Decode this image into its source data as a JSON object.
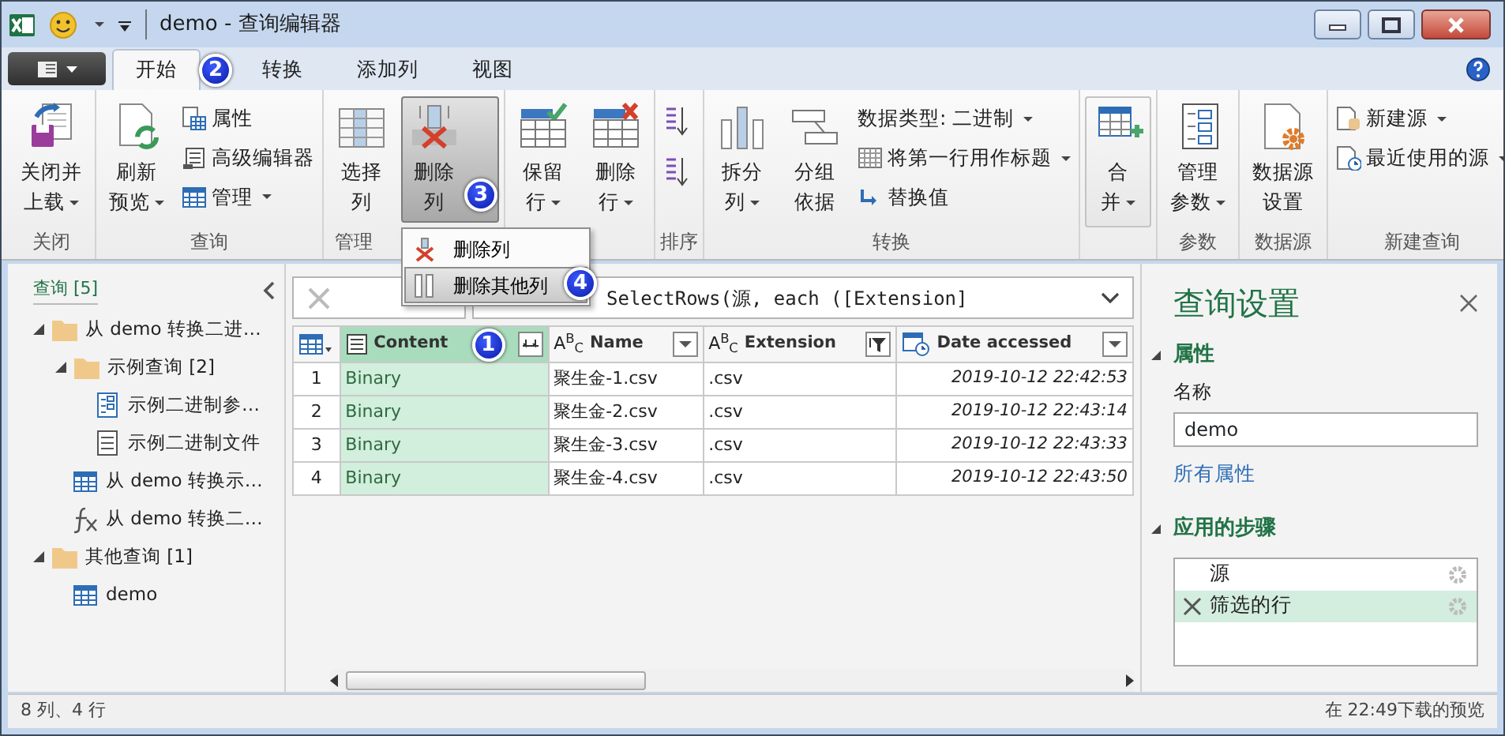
{
  "window": {
    "title": "demo - 查询编辑器"
  },
  "tabs": [
    {
      "label": "开始",
      "selected": true,
      "callout": "2"
    },
    {
      "label": "转换",
      "selected": false
    },
    {
      "label": "添加列",
      "selected": false
    },
    {
      "label": "视图",
      "selected": false
    }
  ],
  "ribbon": [
    {
      "label": "关闭",
      "items": [
        {
          "kind": "large",
          "lines": [
            "关闭并",
            "上载"
          ],
          "dropdown": true
        }
      ]
    },
    {
      "label": "查询",
      "items": [
        {
          "kind": "large",
          "lines": [
            "刷新",
            "预览"
          ],
          "dropdown": true
        },
        {
          "kind": "stack",
          "items": [
            {
              "label": "属性",
              "dropdown": false
            },
            {
              "label": "高级编辑器",
              "dropdown": false
            },
            {
              "label": "管理",
              "dropdown": true
            }
          ]
        }
      ]
    },
    {
      "label": "管理",
      "items": [
        {
          "kind": "large",
          "lines": [
            "选择",
            "列"
          ],
          "dropdown": false
        },
        {
          "kind": "large",
          "lines": [
            "删除",
            "列"
          ],
          "dropdown": false,
          "pressed": true,
          "callout": "3",
          "menu": [
            {
              "label": "删除列",
              "selected": false
            },
            {
              "label": "删除其他列",
              "selected": true,
              "callout": "4"
            }
          ]
        }
      ]
    },
    {
      "items": [
        {
          "kind": "large",
          "lines": [
            "保留",
            "行"
          ],
          "dropdown": true
        },
        {
          "kind": "large",
          "lines": [
            "删除",
            "行"
          ],
          "dropdown": true
        }
      ]
    },
    {
      "label": "排序",
      "items": [
        {
          "kind": "sort"
        }
      ]
    },
    {
      "label": "转换",
      "items": [
        {
          "kind": "large",
          "lines": [
            "拆分",
            "列"
          ],
          "dropdown": true
        },
        {
          "kind": "large",
          "lines": [
            "分组",
            "依据"
          ],
          "dropdown": false
        },
        {
          "kind": "stack",
          "items": [
            {
              "label": "数据类型: 二进制",
              "dropdown": true
            },
            {
              "label": "将第一行用作标题",
              "dropdown": true
            },
            {
              "label": "替换值",
              "dropdown": false
            }
          ]
        }
      ]
    },
    {
      "items": [
        {
          "kind": "large",
          "lines": [
            "合",
            "并"
          ],
          "dropdown": true,
          "highlighted": true
        }
      ]
    },
    {
      "label": "参数",
      "items": [
        {
          "kind": "large",
          "lines": [
            "管理",
            "参数"
          ],
          "dropdown": true
        }
      ]
    },
    {
      "label": "数据源",
      "items": [
        {
          "kind": "large",
          "lines": [
            "数据源",
            "设置"
          ],
          "dropdown": false
        }
      ]
    },
    {
      "label": "新建查询",
      "items": [
        {
          "kind": "stack",
          "items": [
            {
              "label": "新建源",
              "dropdown": true
            },
            {
              "label": "最近使用的源",
              "dropdown": true
            }
          ]
        }
      ]
    }
  ],
  "queries": {
    "header": "查询 [5]",
    "items": [
      {
        "label": "从 demo 转换二进…",
        "kind": "folder",
        "expanded": true,
        "children": [
          {
            "label": "示例查询 [2]",
            "kind": "folder",
            "expanded": true,
            "children": [
              {
                "label": "示例二进制参…",
                "kind": "parameter"
              },
              {
                "label": "示例二进制文件",
                "kind": "list"
              }
            ]
          },
          {
            "label": "从 demo 转换示…",
            "kind": "table"
          },
          {
            "label": "从 demo 转换二…",
            "kind": "function"
          }
        ]
      },
      {
        "label": "其他查询 [1]",
        "kind": "folder",
        "expanded": true,
        "children": [
          {
            "label": "demo",
            "kind": "table"
          }
        ]
      }
    ]
  },
  "formula": "SelectRows(源, each ([Extension]",
  "table": {
    "columns": [
      {
        "kind": "index"
      },
      {
        "name": "Content",
        "kind": "list",
        "selected": true,
        "callout": "1"
      },
      {
        "name": "Name",
        "kind": "text",
        "type_label": "A$^{B}$$_{C}$",
        "filtered": false
      },
      {
        "name": "Extension",
        "kind": "text",
        "type_label": "A$^{B}$$_{C}$",
        "filtered": true
      },
      {
        "name": "Date accessed",
        "kind": "datetime",
        "filtered": false
      }
    ],
    "rows": [
      [
        "1",
        "Binary",
        "聚生金-1.csv",
        ".csv",
        "2019-10-12 22:42:53"
      ],
      [
        "2",
        "Binary",
        "聚生金-2.csv",
        ".csv",
        "2019-10-12 22:43:14"
      ],
      [
        "3",
        "Binary",
        "聚生金-3.csv",
        ".csv",
        "2019-10-12 22:43:33"
      ],
      [
        "4",
        "Binary",
        "聚生金-4.csv",
        ".csv",
        "2019-10-12 22:43:50"
      ]
    ]
  },
  "settings": {
    "title": "查询设置",
    "properties": {
      "header": "属性",
      "expanded": true,
      "name_label": "名称",
      "name_value": "demo",
      "link": "所有属性"
    },
    "steps": {
      "header": "应用的步骤",
      "expanded": true,
      "items": [
        {
          "label": "源",
          "selected": false
        },
        {
          "label": "筛选的行",
          "selected": true
        }
      ]
    }
  },
  "status_bar": {
    "left": "8 列、4 行",
    "right": "在 22:49下载的预览"
  }
}
